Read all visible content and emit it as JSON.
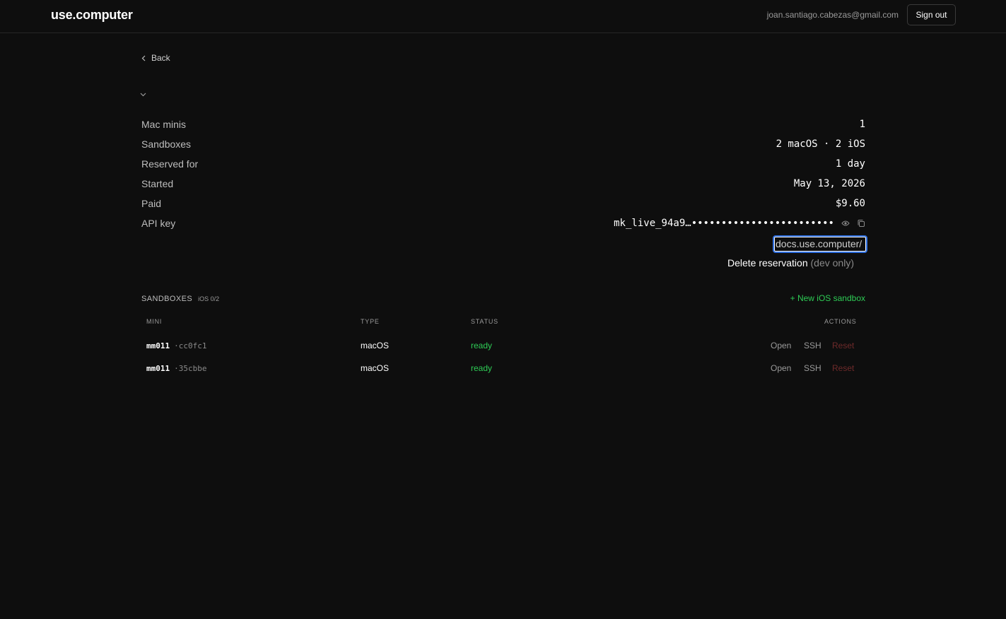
{
  "header": {
    "brand": "use.computer",
    "user_email": "joan.santiago.cabezas@gmail.com",
    "sign_out_label": "Sign out"
  },
  "nav": {
    "back_label": "Back"
  },
  "details": {
    "mac_minis": {
      "label": "Mac minis",
      "value": "1"
    },
    "sandboxes": {
      "label": "Sandboxes",
      "value": "2 macOS · 2 iOS"
    },
    "reserved_for": {
      "label": "Reserved for",
      "value": "1 day"
    },
    "started": {
      "label": "Started",
      "value": "May 13, 2026"
    },
    "paid": {
      "label": "Paid",
      "value": "$9.60"
    },
    "api_key": {
      "label": "API key",
      "value": "mk_live_94a9…••••••••••••••••••••••••",
      "icons": [
        "eye-icon",
        "copy-icon"
      ]
    },
    "docs_link": "docs.use.computer/",
    "delete_label": "Delete reservation",
    "delete_note": "(dev only)"
  },
  "sandboxes": {
    "title": "SANDBOXES",
    "ios_count": "iOS 0/2",
    "new_button": "+ New iOS sandbox",
    "columns": [
      "MINI",
      "TYPE",
      "STATUS",
      "ACTIONS"
    ],
    "rows": [
      {
        "mini": "mm011",
        "id": "·cc0fc1",
        "type": "macOS",
        "status": "ready",
        "actions": [
          "Open",
          "SSH",
          "Reset"
        ]
      },
      {
        "mini": "mm011",
        "id": "·35cbbe",
        "type": "macOS",
        "status": "ready",
        "actions": [
          "Open",
          "SSH",
          "Reset"
        ]
      }
    ]
  },
  "colors": {
    "background": "#0e0e0e",
    "accent_green": "#2ecc55",
    "focus_blue": "#2f6fe0",
    "reset_red": "#6e2a2a"
  }
}
